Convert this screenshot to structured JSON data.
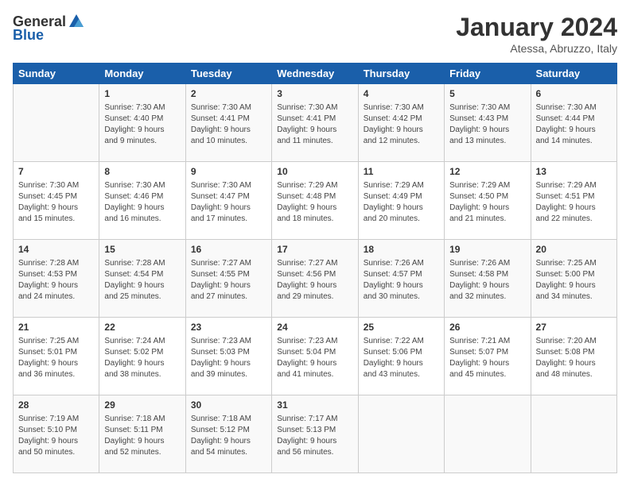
{
  "header": {
    "logo_general": "General",
    "logo_blue": "Blue",
    "month_title": "January 2024",
    "location": "Atessa, Abruzzo, Italy"
  },
  "days_of_week": [
    "Sunday",
    "Monday",
    "Tuesday",
    "Wednesday",
    "Thursday",
    "Friday",
    "Saturday"
  ],
  "weeks": [
    [
      {
        "day": "",
        "sunrise": "",
        "sunset": "",
        "daylight": ""
      },
      {
        "day": "1",
        "sunrise": "Sunrise: 7:30 AM",
        "sunset": "Sunset: 4:40 PM",
        "daylight": "Daylight: 9 hours and 9 minutes."
      },
      {
        "day": "2",
        "sunrise": "Sunrise: 7:30 AM",
        "sunset": "Sunset: 4:41 PM",
        "daylight": "Daylight: 9 hours and 10 minutes."
      },
      {
        "day": "3",
        "sunrise": "Sunrise: 7:30 AM",
        "sunset": "Sunset: 4:41 PM",
        "daylight": "Daylight: 9 hours and 11 minutes."
      },
      {
        "day": "4",
        "sunrise": "Sunrise: 7:30 AM",
        "sunset": "Sunset: 4:42 PM",
        "daylight": "Daylight: 9 hours and 12 minutes."
      },
      {
        "day": "5",
        "sunrise": "Sunrise: 7:30 AM",
        "sunset": "Sunset: 4:43 PM",
        "daylight": "Daylight: 9 hours and 13 minutes."
      },
      {
        "day": "6",
        "sunrise": "Sunrise: 7:30 AM",
        "sunset": "Sunset: 4:44 PM",
        "daylight": "Daylight: 9 hours and 14 minutes."
      }
    ],
    [
      {
        "day": "7",
        "sunrise": "Sunrise: 7:30 AM",
        "sunset": "Sunset: 4:45 PM",
        "daylight": "Daylight: 9 hours and 15 minutes."
      },
      {
        "day": "8",
        "sunrise": "Sunrise: 7:30 AM",
        "sunset": "Sunset: 4:46 PM",
        "daylight": "Daylight: 9 hours and 16 minutes."
      },
      {
        "day": "9",
        "sunrise": "Sunrise: 7:30 AM",
        "sunset": "Sunset: 4:47 PM",
        "daylight": "Daylight: 9 hours and 17 minutes."
      },
      {
        "day": "10",
        "sunrise": "Sunrise: 7:29 AM",
        "sunset": "Sunset: 4:48 PM",
        "daylight": "Daylight: 9 hours and 18 minutes."
      },
      {
        "day": "11",
        "sunrise": "Sunrise: 7:29 AM",
        "sunset": "Sunset: 4:49 PM",
        "daylight": "Daylight: 9 hours and 20 minutes."
      },
      {
        "day": "12",
        "sunrise": "Sunrise: 7:29 AM",
        "sunset": "Sunset: 4:50 PM",
        "daylight": "Daylight: 9 hours and 21 minutes."
      },
      {
        "day": "13",
        "sunrise": "Sunrise: 7:29 AM",
        "sunset": "Sunset: 4:51 PM",
        "daylight": "Daylight: 9 hours and 22 minutes."
      }
    ],
    [
      {
        "day": "14",
        "sunrise": "Sunrise: 7:28 AM",
        "sunset": "Sunset: 4:53 PM",
        "daylight": "Daylight: 9 hours and 24 minutes."
      },
      {
        "day": "15",
        "sunrise": "Sunrise: 7:28 AM",
        "sunset": "Sunset: 4:54 PM",
        "daylight": "Daylight: 9 hours and 25 minutes."
      },
      {
        "day": "16",
        "sunrise": "Sunrise: 7:27 AM",
        "sunset": "Sunset: 4:55 PM",
        "daylight": "Daylight: 9 hours and 27 minutes."
      },
      {
        "day": "17",
        "sunrise": "Sunrise: 7:27 AM",
        "sunset": "Sunset: 4:56 PM",
        "daylight": "Daylight: 9 hours and 29 minutes."
      },
      {
        "day": "18",
        "sunrise": "Sunrise: 7:26 AM",
        "sunset": "Sunset: 4:57 PM",
        "daylight": "Daylight: 9 hours and 30 minutes."
      },
      {
        "day": "19",
        "sunrise": "Sunrise: 7:26 AM",
        "sunset": "Sunset: 4:58 PM",
        "daylight": "Daylight: 9 hours and 32 minutes."
      },
      {
        "day": "20",
        "sunrise": "Sunrise: 7:25 AM",
        "sunset": "Sunset: 5:00 PM",
        "daylight": "Daylight: 9 hours and 34 minutes."
      }
    ],
    [
      {
        "day": "21",
        "sunrise": "Sunrise: 7:25 AM",
        "sunset": "Sunset: 5:01 PM",
        "daylight": "Daylight: 9 hours and 36 minutes."
      },
      {
        "day": "22",
        "sunrise": "Sunrise: 7:24 AM",
        "sunset": "Sunset: 5:02 PM",
        "daylight": "Daylight: 9 hours and 38 minutes."
      },
      {
        "day": "23",
        "sunrise": "Sunrise: 7:23 AM",
        "sunset": "Sunset: 5:03 PM",
        "daylight": "Daylight: 9 hours and 39 minutes."
      },
      {
        "day": "24",
        "sunrise": "Sunrise: 7:23 AM",
        "sunset": "Sunset: 5:04 PM",
        "daylight": "Daylight: 9 hours and 41 minutes."
      },
      {
        "day": "25",
        "sunrise": "Sunrise: 7:22 AM",
        "sunset": "Sunset: 5:06 PM",
        "daylight": "Daylight: 9 hours and 43 minutes."
      },
      {
        "day": "26",
        "sunrise": "Sunrise: 7:21 AM",
        "sunset": "Sunset: 5:07 PM",
        "daylight": "Daylight: 9 hours and 45 minutes."
      },
      {
        "day": "27",
        "sunrise": "Sunrise: 7:20 AM",
        "sunset": "Sunset: 5:08 PM",
        "daylight": "Daylight: 9 hours and 48 minutes."
      }
    ],
    [
      {
        "day": "28",
        "sunrise": "Sunrise: 7:19 AM",
        "sunset": "Sunset: 5:10 PM",
        "daylight": "Daylight: 9 hours and 50 minutes."
      },
      {
        "day": "29",
        "sunrise": "Sunrise: 7:18 AM",
        "sunset": "Sunset: 5:11 PM",
        "daylight": "Daylight: 9 hours and 52 minutes."
      },
      {
        "day": "30",
        "sunrise": "Sunrise: 7:18 AM",
        "sunset": "Sunset: 5:12 PM",
        "daylight": "Daylight: 9 hours and 54 minutes."
      },
      {
        "day": "31",
        "sunrise": "Sunrise: 7:17 AM",
        "sunset": "Sunset: 5:13 PM",
        "daylight": "Daylight: 9 hours and 56 minutes."
      },
      {
        "day": "",
        "sunrise": "",
        "sunset": "",
        "daylight": ""
      },
      {
        "day": "",
        "sunrise": "",
        "sunset": "",
        "daylight": ""
      },
      {
        "day": "",
        "sunrise": "",
        "sunset": "",
        "daylight": ""
      }
    ]
  ]
}
